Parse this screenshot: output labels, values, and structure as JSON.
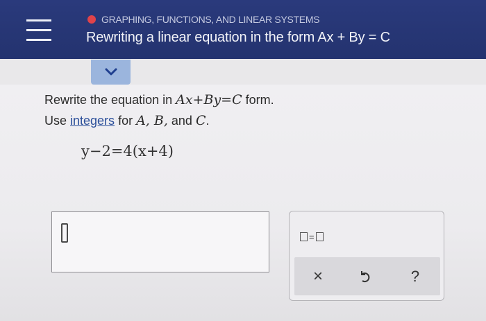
{
  "header": {
    "topic": "GRAPHING, FUNCTIONS, AND LINEAR SYSTEMS",
    "title": "Rewriting a linear equation in the form Ax + By = C",
    "status_dot_color": "#e0434a",
    "menu_icon": "hamburger-icon"
  },
  "collapse_icon": "chevron-down-icon",
  "problem": {
    "line1_pre": "Rewrite the equation in ",
    "line1_math": "Ax+By=C",
    "line1_post": " form.",
    "line2_pre": "Use ",
    "line2_link": "integers",
    "line2_mid": " for ",
    "line2_vars": "A, B,",
    "line2_and": " and ",
    "line2_c": "C",
    "line2_end": ".",
    "equation": "y−2=4(x+4)"
  },
  "answer": {
    "value": ""
  },
  "palette": {
    "equals_template_label": "=",
    "clear_label": "×",
    "help_label": "?",
    "undo_icon": "undo-icon"
  }
}
